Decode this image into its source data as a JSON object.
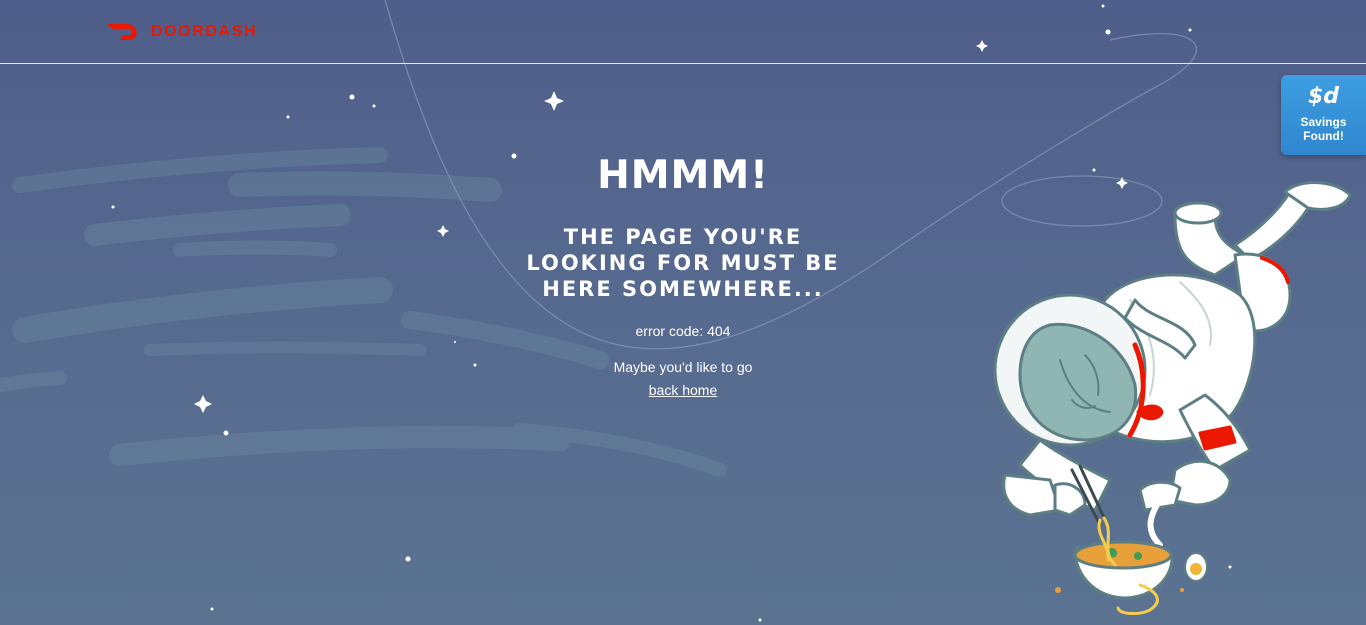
{
  "header": {
    "logo_text": "DOORDASH",
    "brand_color": "#eb1700"
  },
  "error": {
    "headline": "HMMM!",
    "subheadline_lines": [
      "THE PAGE YOU'RE",
      "LOOKING FOR MUST BE",
      "HERE SOMEWHERE..."
    ],
    "code_text": "error code: 404",
    "suggestion_text": "Maybe you'd like to go",
    "link_text": "back home"
  },
  "savings_tab": {
    "icon_text": "$d",
    "label": "Savings Found!",
    "color": "#2f86cf"
  },
  "illustration": {
    "icon": "astronaut-eating-noodles-illustration"
  }
}
